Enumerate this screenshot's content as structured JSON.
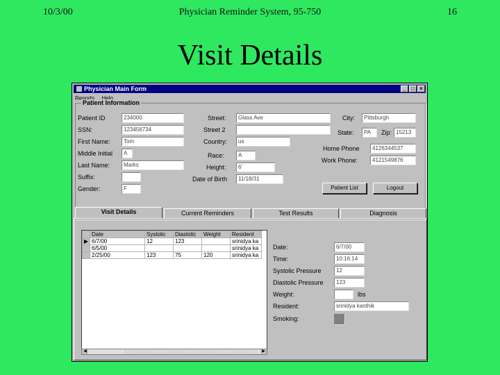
{
  "slide": {
    "date": "10/3/00",
    "header": "Physician Reminder System, 95-750",
    "page_number": "16",
    "title": "Visit Details"
  },
  "window": {
    "title": "Physician Main Form",
    "minimize": "_",
    "maximize": "□",
    "close": "×",
    "menu": [
      "Reports",
      "Help"
    ]
  },
  "patient": {
    "group_label": "Patient Information",
    "labels": {
      "patient_id": "Patient ID",
      "ssn": "SSN:",
      "first_name": "First Name:",
      "middle_initial": "Middle Initial",
      "last_name": "Last Name:",
      "suffix": "Suffix:",
      "gender": "Gender:",
      "street": "Street:",
      "street2": "Street 2",
      "country": "Country:",
      "race": "Race:",
      "height": "Height:",
      "date_of_birth": "Date of Birth",
      "city": "City:",
      "state": "State:",
      "zip": "Zip:",
      "home_phone": "Home Phone",
      "work_phone": "Work Phone:"
    },
    "values": {
      "patient_id": "234000",
      "ssn": "123456734",
      "first_name": "Tom",
      "middle_initial": "A",
      "last_name": "Marks",
      "suffix": "",
      "gender": "F",
      "street": "Glass Ave",
      "street2": "",
      "country": "us",
      "race": "A",
      "height": "6'",
      "date_of_birth": "11/18/31",
      "city": "Pittsburgh",
      "state": "PA",
      "zip": "15213",
      "home_phone": "4126344537",
      "work_phone": "4121549876"
    },
    "buttons": {
      "patient_list": "Patient List",
      "logout": "Logout"
    }
  },
  "tabs": [
    {
      "label": "Visit Details",
      "active": true
    },
    {
      "label": "Current Reminders",
      "active": false
    },
    {
      "label": "Test Results",
      "active": false
    },
    {
      "label": "Diagnosis",
      "active": false
    }
  ],
  "visits": {
    "columns": [
      "Date",
      "Systolic",
      "Diastolic",
      "Weight",
      "Resident"
    ],
    "rows": [
      [
        "6/7/00",
        "12",
        "123",
        "",
        "srinidya ka"
      ],
      [
        "6/5/00",
        "",
        "",
        "",
        "srinidya ka"
      ],
      [
        "2/25/00",
        "123",
        "75",
        "120",
        "srinidya ka"
      ]
    ]
  },
  "detail": {
    "labels": {
      "date": "Date:",
      "time": "Time:",
      "systolic": "Systolic Pressure",
      "diastolic": "Diastolic Pressure",
      "weight": "Weight:",
      "weight_unit": "lbs",
      "resident": "Resident:",
      "smoking": "Smoking:"
    },
    "values": {
      "date": "6/7/00",
      "time": "10:16:14",
      "systolic": "12",
      "diastolic": "123",
      "weight": "",
      "resident": "srinidya kanthik"
    }
  }
}
